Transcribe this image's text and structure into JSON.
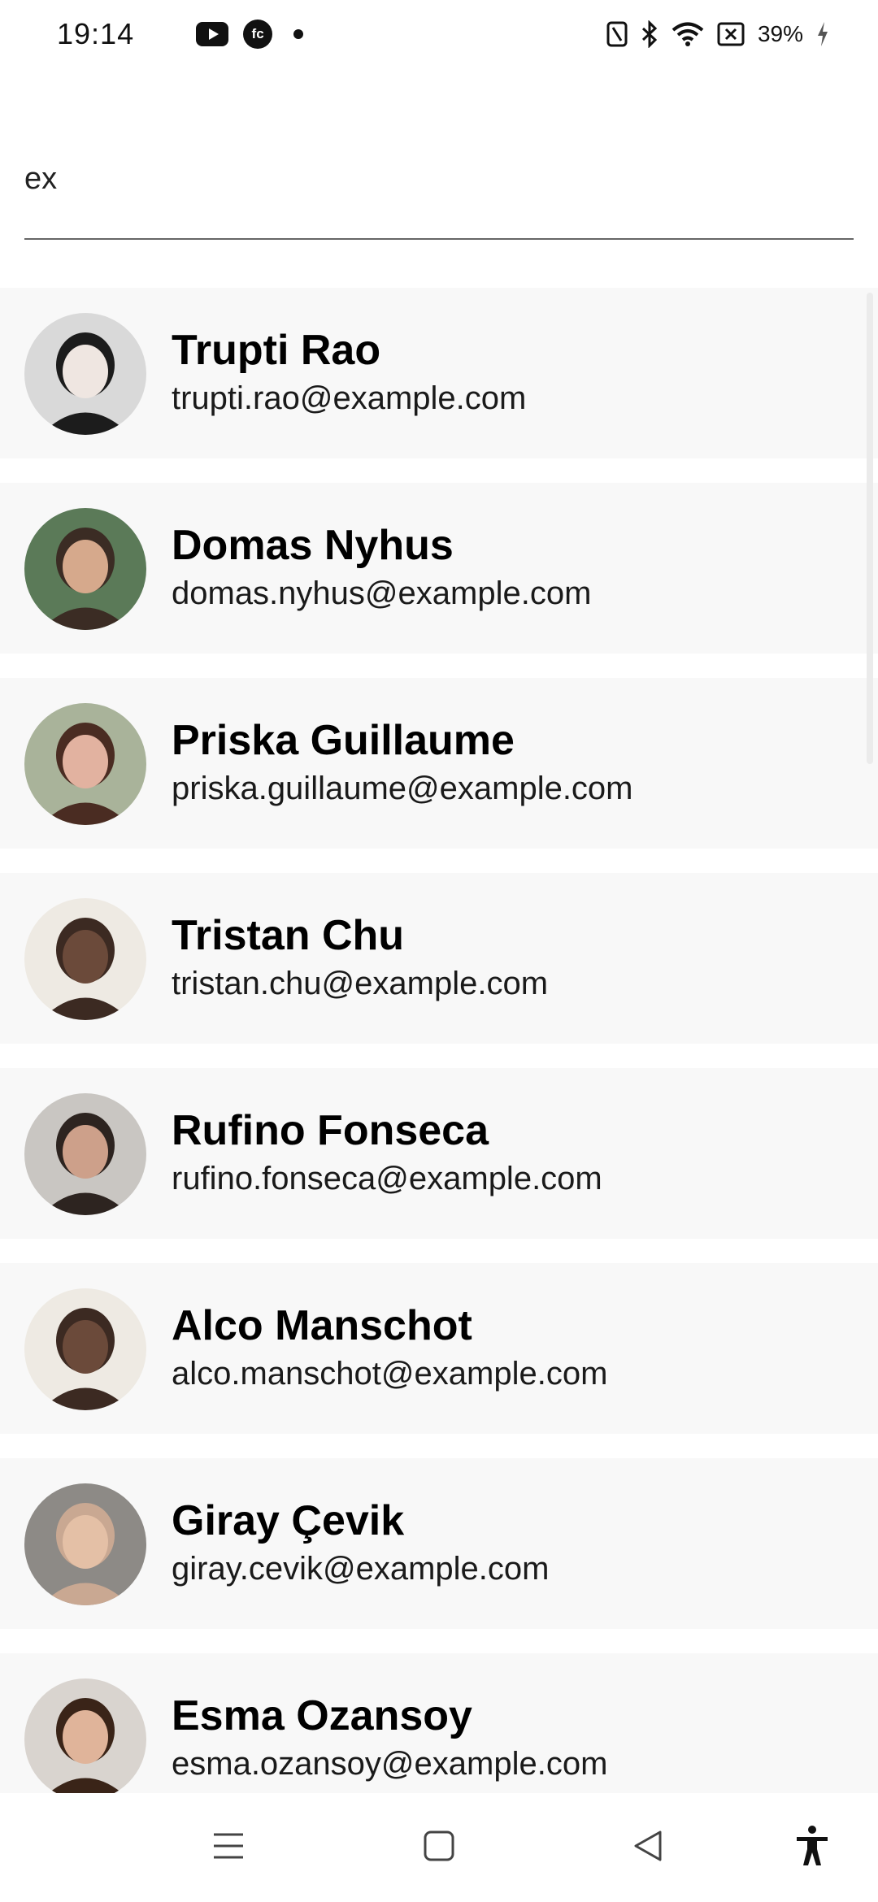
{
  "status_bar": {
    "time": "19:14",
    "battery": "39%",
    "notification_icons": [
      "youtube-icon",
      "fc-app-icon",
      "dot-icon"
    ],
    "system_icons": [
      "nfc-icon",
      "bluetooth-icon",
      "wifi-icon",
      "sim-x-icon",
      "battery-charging-icon"
    ]
  },
  "search": {
    "value": "ex",
    "placeholder": ""
  },
  "contacts": [
    {
      "name": "Trupti Rao",
      "email": "trupti.rao@example.com",
      "avatar_colors": [
        "#d9d9d9",
        "#1c1c1c",
        "#efe6e1"
      ]
    },
    {
      "name": "Domas Nyhus",
      "email": "domas.nyhus@example.com",
      "avatar_colors": [
        "#5b7a58",
        "#3b2c24",
        "#d6a98c"
      ]
    },
    {
      "name": "Priska Guillaume",
      "email": "priska.guillaume@example.com",
      "avatar_colors": [
        "#a9b39a",
        "#4a2c22",
        "#e2b2a0"
      ]
    },
    {
      "name": "Tristan Chu",
      "email": "tristan.chu@example.com",
      "avatar_colors": [
        "#eeeae3",
        "#3c2a22",
        "#6b4a3a"
      ]
    },
    {
      "name": "Rufino Fonseca",
      "email": "rufino.fonseca@example.com",
      "avatar_colors": [
        "#c9c6c2",
        "#2d2420",
        "#cda08a"
      ]
    },
    {
      "name": "Alco Manschot",
      "email": "alco.manschot@example.com",
      "avatar_colors": [
        "#eeeae3",
        "#3c2a22",
        "#6b4a3a"
      ]
    },
    {
      "name": "Giray Çevik",
      "email": "giray.cevik@example.com",
      "avatar_colors": [
        "#8d8a86",
        "#c9a892",
        "#e4c0a6"
      ]
    },
    {
      "name": "Esma Ozansoy",
      "email": "esma.ozansoy@example.com",
      "avatar_colors": [
        "#d9d4cf",
        "#3a2418",
        "#e0b49a"
      ]
    }
  ],
  "nav_bar": {
    "buttons": [
      "menu-icon",
      "home-icon",
      "back-icon",
      "accessibility-icon"
    ]
  }
}
